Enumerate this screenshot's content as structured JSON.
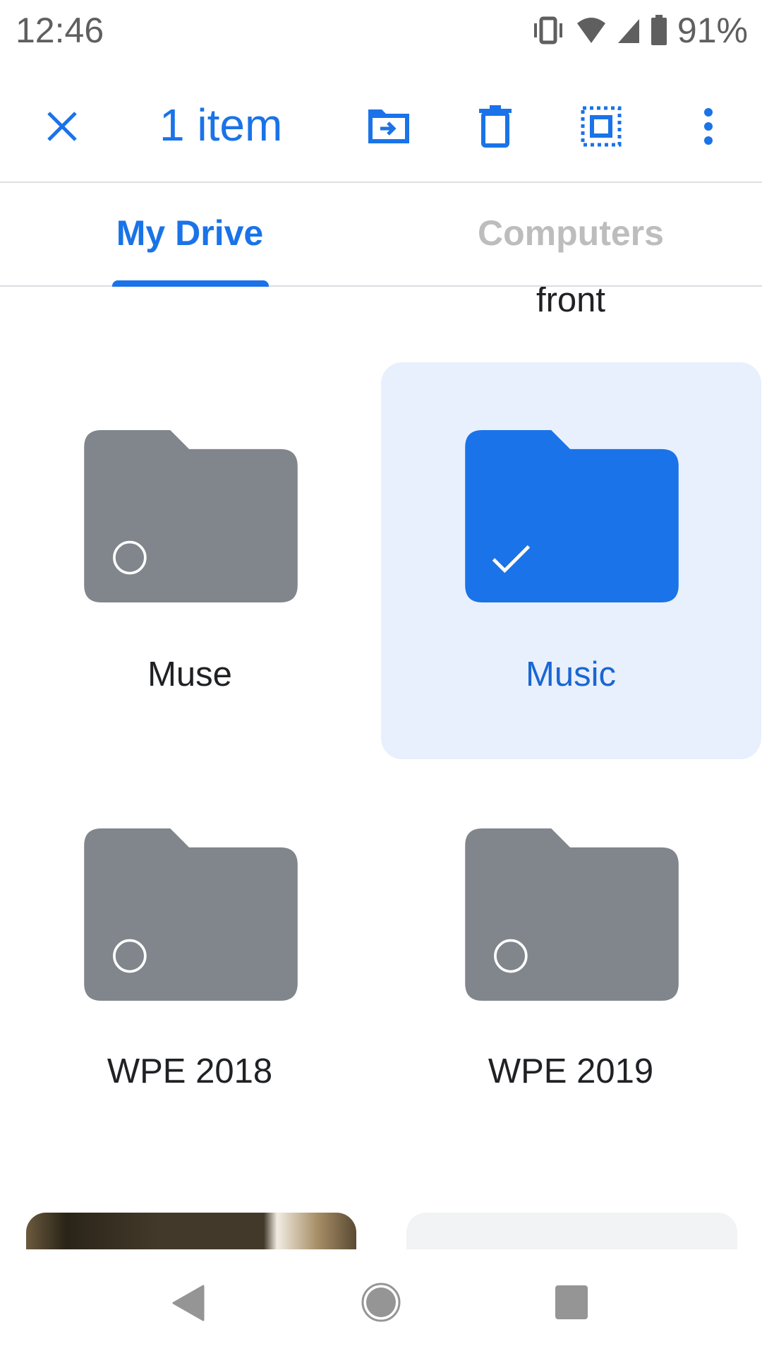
{
  "status_bar": {
    "time": "12:46",
    "battery": "91%",
    "icons": [
      "vibrate-icon",
      "wifi-icon",
      "signal-icon",
      "battery-icon"
    ]
  },
  "toolbar": {
    "title": "1 item",
    "icons": [
      "close-icon",
      "move-icon",
      "trash-icon",
      "select-all-icon",
      "more-vert-icon"
    ]
  },
  "tabs": [
    {
      "label": "My Drive",
      "active": true
    },
    {
      "label": "Computers",
      "active": false
    }
  ],
  "colors": {
    "accent": "#1a73e8",
    "folder_gray": "#80868b",
    "selected_bg": "#e8f0fd"
  },
  "grid": {
    "partial_label_right": "front",
    "folders": [
      {
        "name": "Muse",
        "selected": false
      },
      {
        "name": "Music",
        "selected": true
      },
      {
        "name": "WPE 2018",
        "selected": false
      },
      {
        "name": "WPE 2019",
        "selected": false
      }
    ]
  },
  "nav": {
    "icons": [
      "back-icon",
      "home-icon",
      "recents-icon"
    ]
  }
}
